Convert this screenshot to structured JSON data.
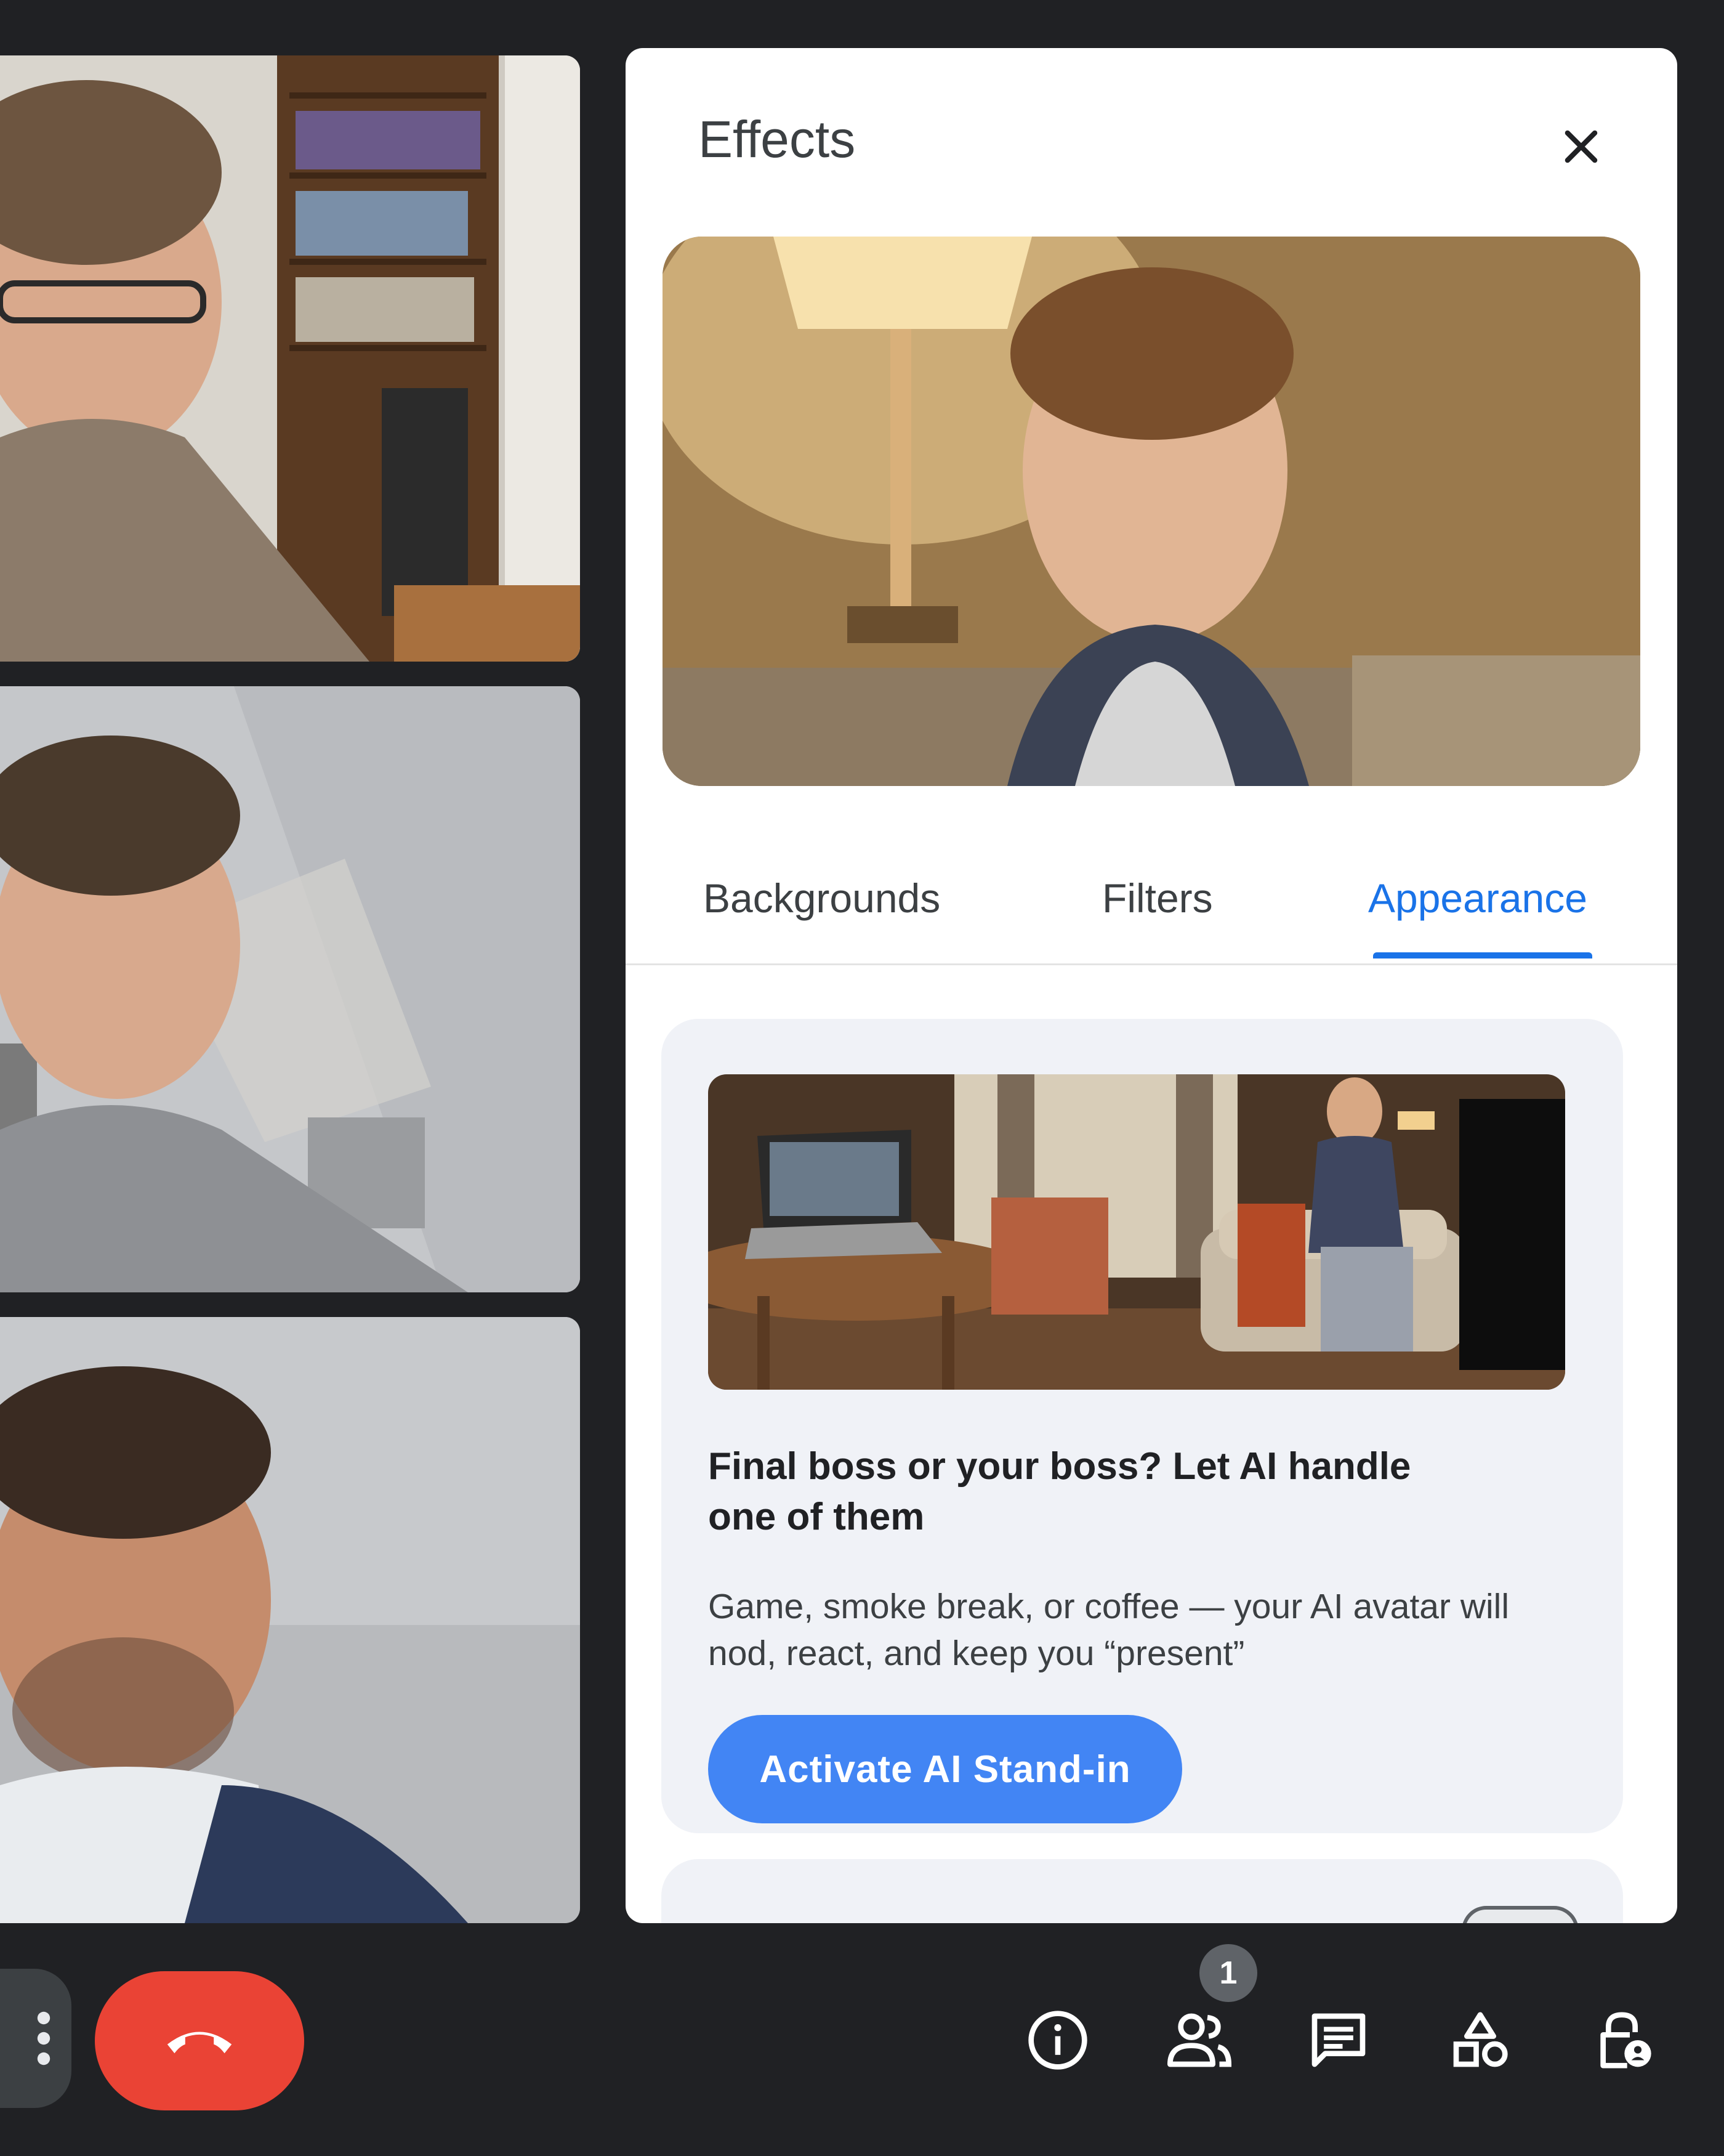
{
  "participants": [
    {
      "id": "participant-1"
    },
    {
      "id": "participant-2"
    },
    {
      "id": "participant-3"
    }
  ],
  "effects_panel": {
    "title": "Effects",
    "close_icon": "close-icon",
    "tabs": [
      {
        "label": "Backgrounds",
        "selected": false
      },
      {
        "label": "Filters",
        "selected": false
      },
      {
        "label": "Appearance",
        "selected": true
      }
    ],
    "promo": {
      "heading": "Final boss or your boss? Let AI handle one of them",
      "body": "Game, smoke break, or coffee — your AI avatar will nod, react, and keep you “present”",
      "button_label": "Activate AI Stand-in"
    }
  },
  "controls": {
    "more_icon": "more-vert-icon",
    "hangup_icon": "call-end-icon",
    "info_icon": "info-icon",
    "people_icon": "people-icon",
    "people_badge": "1",
    "chat_icon": "chat-icon",
    "activities_icon": "activities-icon",
    "host_controls_icon": "host-controls-icon"
  },
  "colors": {
    "background": "#202124",
    "accent": "#1a73e8",
    "button": "#4285f4",
    "hangup": "#ea4335"
  }
}
